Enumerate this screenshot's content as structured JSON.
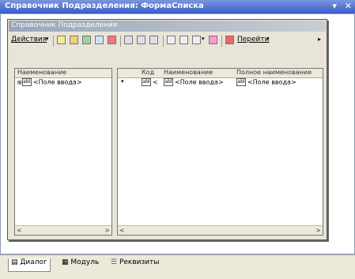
{
  "window": {
    "title": "Справочник Подразделения: ФормаСписка",
    "pin": "▾",
    "close": "✕"
  },
  "form": {
    "title": "Справочник Подразделения"
  },
  "toolbar": {
    "actions_label": "Действия",
    "goto_label": "Перейти",
    "more": "▸"
  },
  "left_panel": {
    "header": "Наименование",
    "row_text": "<Поле ввода>",
    "field_icon": "abl"
  },
  "right_panel": {
    "headers": [
      "Код",
      "Наименование",
      "Полное наименование"
    ],
    "row": {
      "code": "<",
      "name": "<Поле ввода>",
      "fullname": "<Поле ввода>"
    },
    "field_icon": "abl"
  },
  "scroll": {
    "left_arrow": "<",
    "right_arrow": ">"
  },
  "tabs": [
    {
      "label": "Диалог",
      "icon": "dialog-icon",
      "active": true
    },
    {
      "label": "Модуль",
      "icon": "module-icon",
      "active": false
    },
    {
      "label": "Реквизиты",
      "icon": "attributes-icon",
      "active": false
    }
  ],
  "colors": {
    "title_blue": "#3a5cc8",
    "form_bg": "#e8e4d8"
  }
}
